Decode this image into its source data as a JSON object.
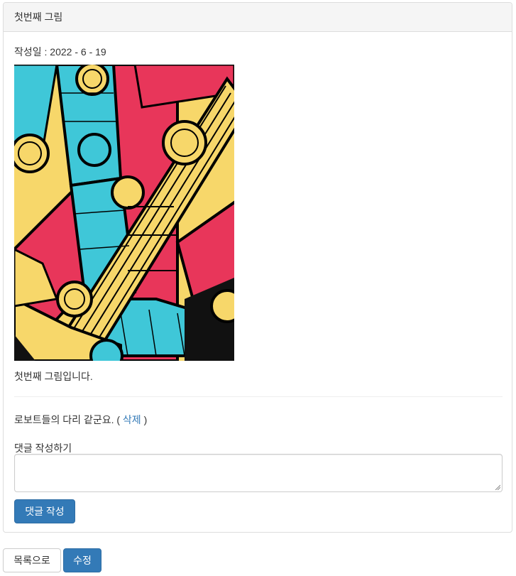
{
  "post": {
    "title": "첫번째 그림",
    "date_line": "작성일 : 2022 - 6 - 19",
    "content": "첫번째 그림입니다.",
    "image_icon": "robot-legs-artwork"
  },
  "comments": [
    {
      "text": "로보트들의 다리 같군요.",
      "open": "(",
      "delete_label": "삭제",
      "close": ")"
    }
  ],
  "comment_form": {
    "label": "댓글 작성하기",
    "value": "",
    "submit_label": "댓글 작성"
  },
  "actions": {
    "list_label": "목록으로",
    "edit_label": "수정"
  },
  "colors": {
    "primary": "#337ab7",
    "link": "#337ab7",
    "art_red": "#e8365a",
    "art_cyan": "#3fc7d8",
    "art_yellow": "#f7d76a"
  }
}
